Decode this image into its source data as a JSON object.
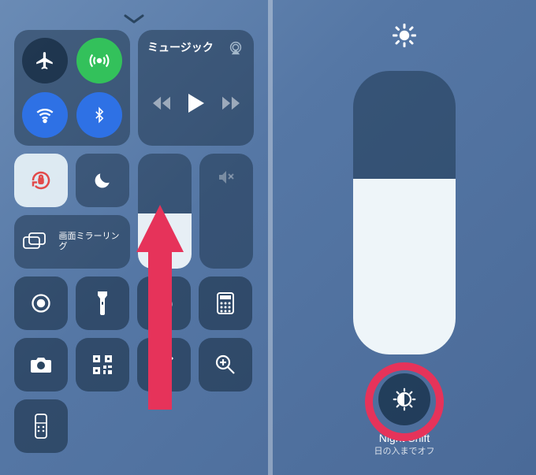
{
  "left": {
    "music": {
      "title": "ミュージック"
    },
    "screen_mirroring": {
      "label": "画面ミラーリング"
    },
    "brightness_fill_pct": 48,
    "volume_fill_pct": 0
  },
  "right": {
    "brightness_fill_pct": 62,
    "night_shift": {
      "title": "Night Shift",
      "subtitle": "日の入までオフ"
    }
  },
  "colors": {
    "annotation": "#e6335a"
  }
}
